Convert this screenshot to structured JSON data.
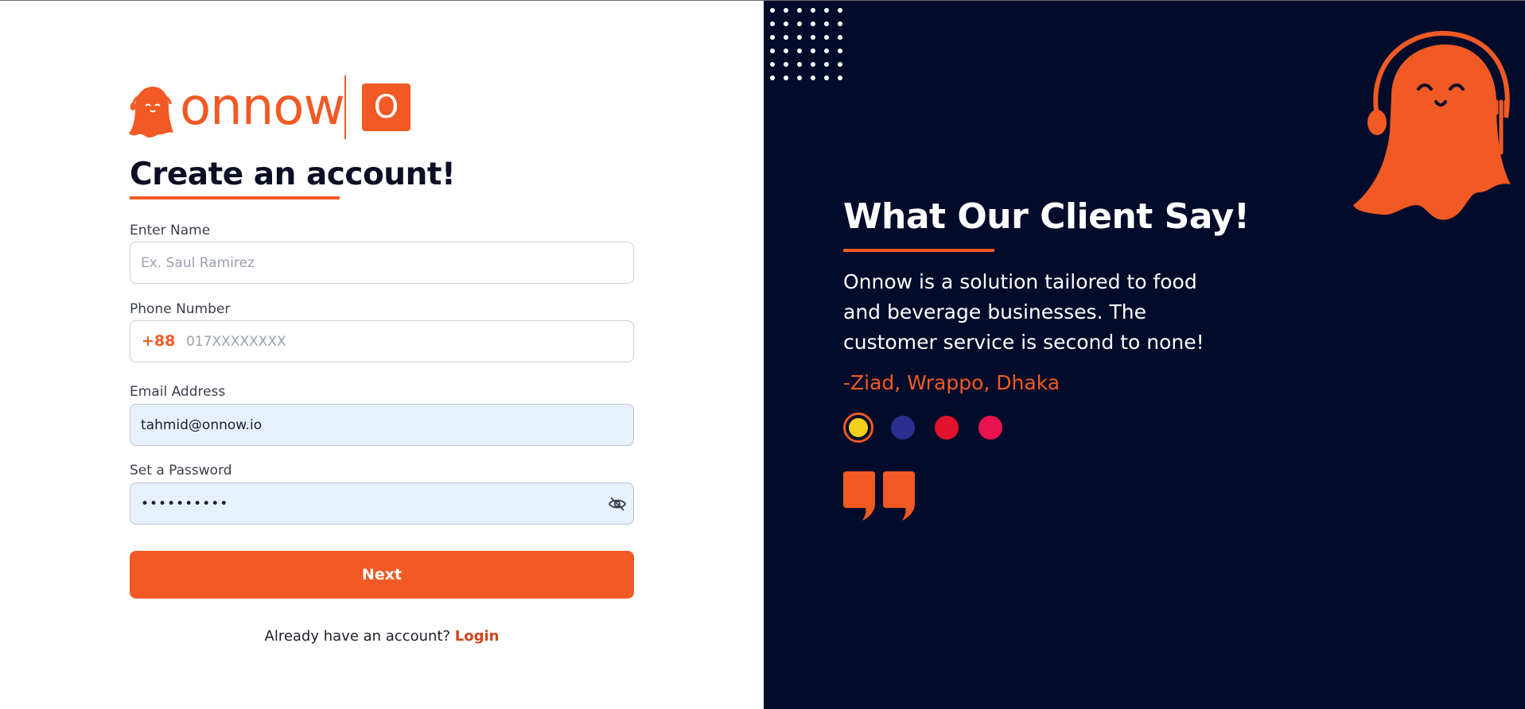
{
  "brand": {
    "wordmark": "onnow",
    "badge_letter": "O",
    "accent": "#f15a24",
    "panel_bg": "#020c2a"
  },
  "signup": {
    "title": "Create an account!",
    "fields": {
      "name": {
        "label": "Enter Name",
        "placeholder": "Ex. Saul Ramirez",
        "value": ""
      },
      "phone": {
        "label": "Phone Number",
        "prefix": "+88",
        "placeholder": "017XXXXXXXX",
        "value": ""
      },
      "email": {
        "label": "Email Address",
        "value": "tahmid@onnow.io"
      },
      "password": {
        "label": "Set a Password",
        "value": "••••••••••",
        "toggle_icon": "eye-off-icon"
      }
    },
    "next_label": "Next",
    "login_prompt": "Already have an account?",
    "login_label": "Login"
  },
  "testimonial": {
    "title": "What Our Client Say!",
    "quote": "Onnow is a solution tailored to food and beverage businesses. The customer service is second to none!",
    "author": "-Ziad, Wrappo, Dhaka",
    "client_logos": [
      {
        "icon": "yellow-client-logo",
        "color": "#f3d11a",
        "active": true
      },
      {
        "icon": "wrappo-logo",
        "color": "#2b2f8f",
        "active": false
      },
      {
        "icon": "red-client-logo",
        "color": "#e3122d",
        "active": false
      },
      {
        "icon": "pink-client-logo",
        "color": "#e8124f",
        "active": false
      }
    ],
    "quote_icon": "quote-marks-icon"
  }
}
